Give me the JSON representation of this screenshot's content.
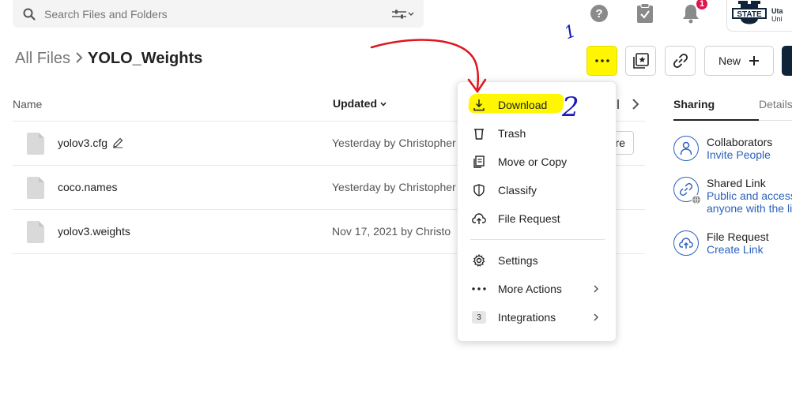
{
  "search": {
    "placeholder": "Search Files and Folders"
  },
  "header": {
    "notification_count": "1",
    "logo_text": "STATE",
    "logo_side_line1": "Uta",
    "logo_side_line2": "Uni"
  },
  "breadcrumb": {
    "root": "All Files",
    "current": "YOLO_Weights"
  },
  "toolbar": {
    "new_label": "New"
  },
  "list": {
    "col_name": "Name",
    "col_updated": "Updated",
    "rows": [
      {
        "name": "yolov3.cfg",
        "updated": "Yesterday by Christopher"
      },
      {
        "name": "coco.names",
        "updated": "Yesterday by Christopher"
      },
      {
        "name": "yolov3.weights",
        "updated": "Nov 17, 2021 by Christo"
      }
    ],
    "share_button_partial": "re"
  },
  "menu": {
    "items": [
      {
        "label": "Download",
        "icon": "download-icon"
      },
      {
        "label": "Trash",
        "icon": "trash-icon"
      },
      {
        "label": "Move or Copy",
        "icon": "move-copy-icon"
      },
      {
        "label": "Classify",
        "icon": "shield-icon"
      },
      {
        "label": "File Request",
        "icon": "upload-cloud-icon"
      },
      {
        "label": "Settings",
        "icon": "gear-icon"
      },
      {
        "label": "More Actions",
        "icon": "ellipsis-icon"
      },
      {
        "label": "Integrations",
        "icon": "integrations-badge",
        "badge": "3"
      }
    ]
  },
  "side_panel": {
    "tab_sharing": "Sharing",
    "tab_details": "Details",
    "collaborators_title": "Collaborators",
    "collaborators_link": "Invite People",
    "shared_link_title": "Shared Link",
    "shared_link_line1": "Public and access",
    "shared_link_line2": "anyone with the li",
    "file_request_title": "File Request",
    "file_request_link": "Create Link"
  },
  "annotations": {
    "step1": "1",
    "step2": "2"
  },
  "colors": {
    "highlight": "#fff600",
    "annotation": "#1a1ab5",
    "arrow": "#e0141e",
    "link": "#2a62bc",
    "brand_dark": "#0f2439"
  }
}
